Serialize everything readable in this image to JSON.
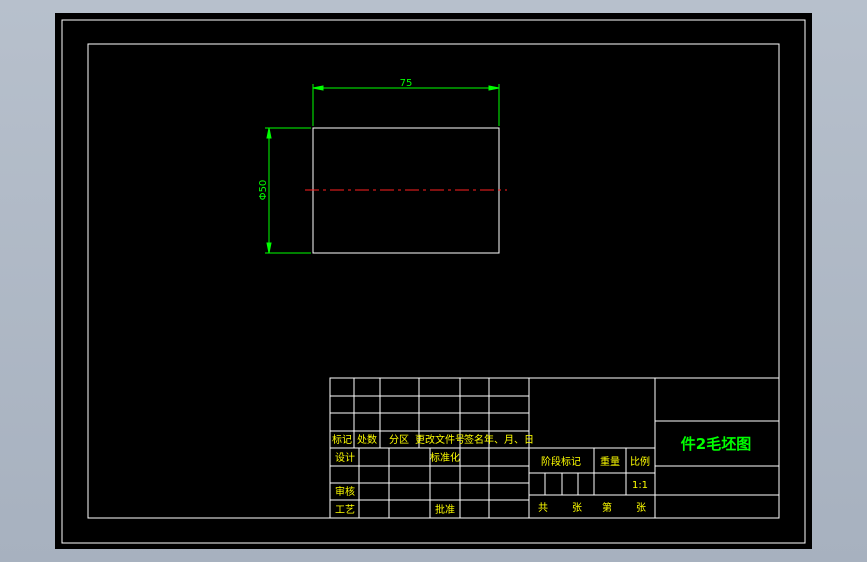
{
  "colors": {
    "background": "#000000",
    "frame": "#ffffff",
    "dimension": "#00ff00",
    "centerline": "#ff0000",
    "title_text": "#00ff00",
    "table_text": "#ffff00",
    "desktop": "#aab3c0"
  },
  "drawing": {
    "dim_width": "75",
    "dim_diameter": "Φ50"
  },
  "title_block": {
    "part_title": "件2毛坯图",
    "scale_value": "1:1",
    "row_headers": [
      "标记",
      "处数",
      "分区",
      "更改文件号",
      "签名",
      "年、月、日"
    ],
    "design": "设计",
    "standardization": "标准化",
    "review": "审核",
    "process": "工艺",
    "approve": "批准",
    "stage_mark": "阶段标记",
    "weight": "重量",
    "scale": "比例",
    "total": "共",
    "sheets": "张",
    "sheet_no": "第",
    "sheet_unit": "张"
  }
}
